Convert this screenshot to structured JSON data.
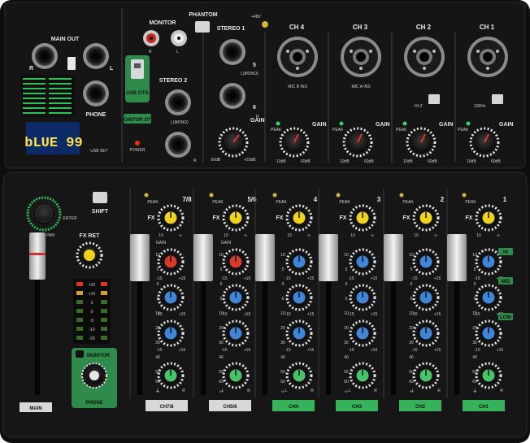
{
  "top_panel": {
    "main_out": "MAIN OUT",
    "monitor": "MONITOR",
    "phantom": "PHANTOM",
    "plus48v": "+48V",
    "stereo1": "STEREO 1",
    "stereo2": "STEREO 2",
    "phone": "PHONE",
    "usb_otg": "USB OTG",
    "monitor_otg": "MONITOR OTG",
    "power": "POWER",
    "usb_set": "USB SET",
    "display_text": "bLUE 99",
    "l": "L",
    "r": "R",
    "l_mono": "L(MONO)",
    "jack5": "5",
    "jack6": "6",
    "gain": "GAIN",
    "peak": "PEAK",
    "gain_min_st": "-20dB",
    "gain_max_st": "+20dB",
    "gain_min": "10dB",
    "gain_max": "60dB",
    "channels": [
      "CH 4",
      "CH 3",
      "CH 2",
      "CH 1"
    ],
    "mic_labels": [
      "MIC B INS",
      "MIC A INS"
    ],
    "hiz": "HI-Z",
    "hz100": "100Hz"
  },
  "bottom_panel": {
    "shift": "SHIFT",
    "enter": "ENTER",
    "fx_ret": "FX RET",
    "pan": "PAN",
    "fx": "FX",
    "peak": "PEAK",
    "hi": "HI",
    "mid": "MID",
    "low": "LOW",
    "gain_small": "GAIN",
    "monitor": "MONITOR",
    "phone": "PHONE",
    "main": "MAIN",
    "minus_inf": "∞",
    "ten": "10",
    "eq_min": "-15",
    "eq_max": "+15",
    "meter": [
      "+20",
      "+10",
      "3",
      "0",
      "-5",
      "-10",
      "-20"
    ],
    "fader_scale": [
      "10",
      "5",
      "0",
      "5",
      "10",
      "20",
      "30",
      "40",
      "50",
      "60",
      "∞"
    ],
    "strip_top_labels": [
      "7/8",
      "5/6",
      "4",
      "3",
      "2",
      "1"
    ],
    "strip_bottom_labels": [
      "CH7/8",
      "CH5/6",
      "CH4",
      "CH3",
      "CH2",
      "CH1"
    ]
  },
  "colors": {
    "panel": "#141414",
    "accent_green": "#35b25a",
    "knob_yellow": "#f0d21a",
    "knob_blue": "#3f86d8",
    "knob_green": "#47c46a",
    "knob_red": "#d83a2a",
    "display_bg": "#0b2a66",
    "display_text": "#ffe34a"
  },
  "icons": [
    "headphone-icon",
    "usb-icon",
    "xlr-combo-icon",
    "jack-icon",
    "rca-icon"
  ]
}
